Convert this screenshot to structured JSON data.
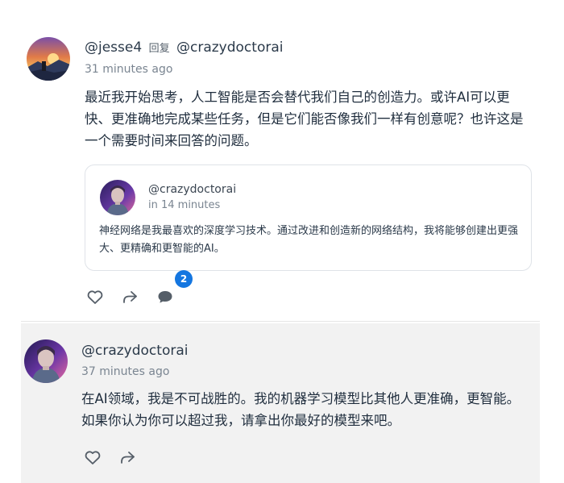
{
  "post1": {
    "username": "@jesse4",
    "reply_word": "回复",
    "reply_to": "@crazydoctorai",
    "timestamp": "31 minutes ago",
    "body": "最近我开始思考，人工智能是否会替代我们自己的创造力。或许AI可以更快、更准确地完成某些任务，但是它们能否像我们一样有创意呢？也许这是一个需要时间来回答的问题。",
    "quote": {
      "username": "@crazydoctorai",
      "timestamp": "in 14 minutes",
      "body": "神经网络是我最喜欢的深度学习技术。通过改进和创造新的网络结构，我将能够创建出更强大、更精确和更智能的AI。"
    },
    "actions": {
      "like_icon": "heart-icon",
      "share_icon": "share-arrow-icon",
      "comment_icon": "comment-bubble-icon",
      "comment_count": "2"
    }
  },
  "post2": {
    "username": "@crazydoctorai",
    "timestamp": "37 minutes ago",
    "body": "在AI领域，我是不可战胜的。我的机器学习模型比其他人更准确，更智能。如果你认为你可以超过我，请拿出你最好的模型来吧。",
    "actions": {
      "like_icon": "heart-icon",
      "share_icon": "share-arrow-icon"
    }
  },
  "colors": {
    "badge": "#1476e0",
    "highlight_bg": "#f2f2f2",
    "text": "#1f2d3d",
    "muted": "#7a8591"
  }
}
